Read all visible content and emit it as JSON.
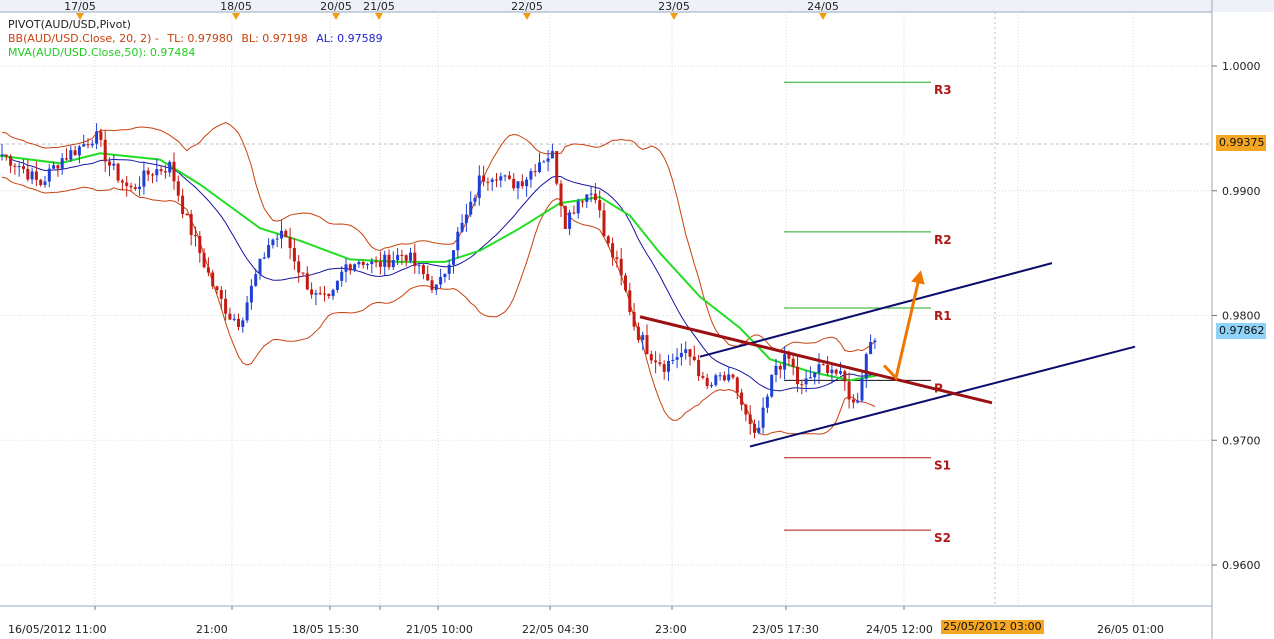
{
  "legend": {
    "pivot": "PIVOT(AUD/USD,Pivot)",
    "bb_prefix": "BB(AUD/USD.Close, 20, 2) -",
    "bb_tl": "TL: 0.97980",
    "bb_bl": "BL: 0.97198",
    "bb_al": "AL: 0.97589",
    "mva": "MVA(AUD/USD.Close,50): 0.97484"
  },
  "price_badges": {
    "top": "0.99375",
    "current": "0.97862"
  },
  "time_badge": "25/05/2012 03:00",
  "colors": {
    "candle_up": "#1f3fd6",
    "candle_down": "#c41a14",
    "bollinger": "#c8420e",
    "bb_mid": "#1515a0",
    "mva": "#22dd22",
    "trend_channel": "#0d0d6e",
    "trendline": "#9b1010",
    "arrow": "#ee7700",
    "resistance": "#22aa22",
    "support": "#b01818"
  },
  "chart_data": {
    "type": "candlestick",
    "symbol": "AUD/USD",
    "ylim": [
      0.9575,
      1.0045
    ],
    "y_ticks": [
      "1.0000",
      "0.9900",
      "0.9800",
      "0.9700",
      "0.9600"
    ],
    "top_dates": [
      "17/05",
      "18/05",
      "20/05",
      "21/05",
      "22/05",
      "23/05",
      "24/05"
    ],
    "x_ticks": [
      "16/05/2012 11:00",
      "21:00",
      "18/05 15:30",
      "21/05 10:00",
      "22/05 04:30",
      "23:00",
      "23/05 17:30",
      "24/05 12:00",
      "26/05 01:00"
    ],
    "pivot_levels": [
      {
        "label": "R3",
        "value": 0.9987
      },
      {
        "label": "R2",
        "value": 0.9867
      },
      {
        "label": "R1",
        "value": 0.9806
      },
      {
        "label": "P",
        "value": 0.9748
      },
      {
        "label": "S1",
        "value": 0.9686
      },
      {
        "label": "S2",
        "value": 0.9628
      }
    ],
    "price_path": [
      [
        0,
        0.993
      ],
      [
        20,
        0.992
      ],
      [
        40,
        0.9905
      ],
      [
        60,
        0.9925
      ],
      [
        80,
        0.9935
      ],
      [
        95,
        0.9945
      ],
      [
        110,
        0.992
      ],
      [
        130,
        0.99
      ],
      [
        150,
        0.9915
      ],
      [
        170,
        0.992
      ],
      [
        185,
        0.988
      ],
      [
        200,
        0.985
      ],
      [
        215,
        0.982
      ],
      [
        230,
        0.98
      ],
      [
        240,
        0.9795
      ],
      [
        255,
        0.983
      ],
      [
        270,
        0.986
      ],
      [
        285,
        0.9865
      ],
      [
        300,
        0.9835
      ],
      [
        315,
        0.9815
      ],
      [
        330,
        0.981
      ],
      [
        345,
        0.984
      ],
      [
        360,
        0.9845
      ],
      [
        375,
        0.984
      ],
      [
        390,
        0.9845
      ],
      [
        405,
        0.985
      ],
      [
        420,
        0.9835
      ],
      [
        438,
        0.982
      ],
      [
        455,
        0.986
      ],
      [
        470,
        0.9885
      ],
      [
        480,
        0.991
      ],
      [
        495,
        0.9915
      ],
      [
        510,
        0.9905
      ],
      [
        525,
        0.991
      ],
      [
        540,
        0.9925
      ],
      [
        552,
        0.993
      ],
      [
        565,
        0.9875
      ],
      [
        580,
        0.9895
      ],
      [
        595,
        0.99
      ],
      [
        605,
        0.986
      ],
      [
        615,
        0.9845
      ],
      [
        625,
        0.982
      ],
      [
        635,
        0.979
      ],
      [
        650,
        0.977
      ],
      [
        665,
        0.976
      ],
      [
        680,
        0.977
      ],
      [
        695,
        0.9765
      ],
      [
        705,
        0.974
      ],
      [
        720,
        0.975
      ],
      [
        735,
        0.9745
      ],
      [
        745,
        0.972
      ],
      [
        755,
        0.97
      ],
      [
        765,
        0.9725
      ],
      [
        775,
        0.976
      ],
      [
        790,
        0.9765
      ],
      [
        800,
        0.974
      ],
      [
        815,
        0.9755
      ],
      [
        830,
        0.976
      ],
      [
        845,
        0.9745
      ],
      [
        855,
        0.9725
      ],
      [
        865,
        0.9765
      ],
      [
        872,
        0.9785
      ],
      [
        877,
        0.9786
      ]
    ],
    "mva_path": [
      [
        0,
        0.9928
      ],
      [
        60,
        0.9922
      ],
      [
        100,
        0.993
      ],
      [
        160,
        0.9925
      ],
      [
        200,
        0.9905
      ],
      [
        260,
        0.987
      ],
      [
        300,
        0.986
      ],
      [
        350,
        0.9845
      ],
      [
        400,
        0.9843
      ],
      [
        445,
        0.9843
      ],
      [
        480,
        0.9852
      ],
      [
        520,
        0.987
      ],
      [
        560,
        0.989
      ],
      [
        600,
        0.9895
      ],
      [
        630,
        0.988
      ],
      [
        660,
        0.985
      ],
      [
        700,
        0.9815
      ],
      [
        740,
        0.979
      ],
      [
        770,
        0.9765
      ],
      [
        810,
        0.9755
      ],
      [
        850,
        0.9748
      ],
      [
        877,
        0.9752
      ]
    ],
    "annotations": {
      "trend_channel_upper": [
        [
          700,
          0.9767
        ],
        [
          1052,
          0.9842
        ]
      ],
      "trend_channel_lower": [
        [
          750,
          0.9695
        ],
        [
          1135,
          0.9775
        ]
      ],
      "descending_trendline": [
        [
          640,
          0.9799
        ],
        [
          992,
          0.973
        ]
      ],
      "arrow_path": [
        [
          884,
          0.976
        ],
        [
          896,
          0.975
        ],
        [
          920,
          0.9833
        ]
      ]
    }
  }
}
